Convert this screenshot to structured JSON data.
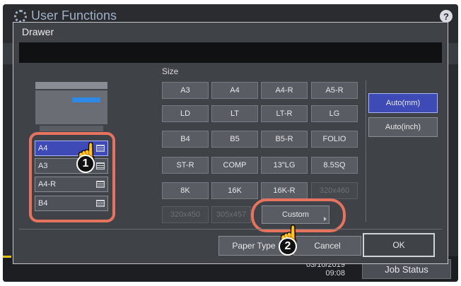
{
  "background": {
    "app_title": "User Functions",
    "help_label": "?",
    "datetime": "03/10/2019\n09:08",
    "job_status_label": "Job Status"
  },
  "dialog": {
    "title": "Drawer",
    "message": ""
  },
  "drawers": [
    {
      "label": "A4",
      "selected": true
    },
    {
      "label": "A3",
      "selected": false
    },
    {
      "label": "A4-R",
      "selected": false
    },
    {
      "label": "B4",
      "selected": false
    }
  ],
  "size": {
    "label": "Size",
    "buttons": [
      [
        "A3",
        "A4",
        "A4-R",
        "A5-R"
      ],
      [
        "LD",
        "LT",
        "LT-R",
        "LG"
      ],
      [
        "B4",
        "B5",
        "B5-R",
        "FOLIO"
      ],
      [
        "ST-R",
        "COMP",
        "13\"LG",
        "8.5SQ"
      ],
      [
        "8K",
        "16K",
        "16K-R",
        "320x460"
      ],
      [
        "320x450",
        "305x457"
      ]
    ],
    "disabled": [
      "320x460",
      "320x450",
      "305x457"
    ],
    "custom_label": "Custom"
  },
  "units": {
    "auto_mm": "Auto(mm)",
    "auto_inch": "Auto(inch)",
    "selected": "Auto(mm)"
  },
  "footer": {
    "paper_type": "Paper Type",
    "cancel": "Cancel",
    "ok": "OK"
  },
  "callouts": {
    "step1": "1",
    "step2": "2"
  },
  "colors": {
    "highlight_outline": "#e6735e",
    "selected_blue": "#3e4ab6"
  }
}
